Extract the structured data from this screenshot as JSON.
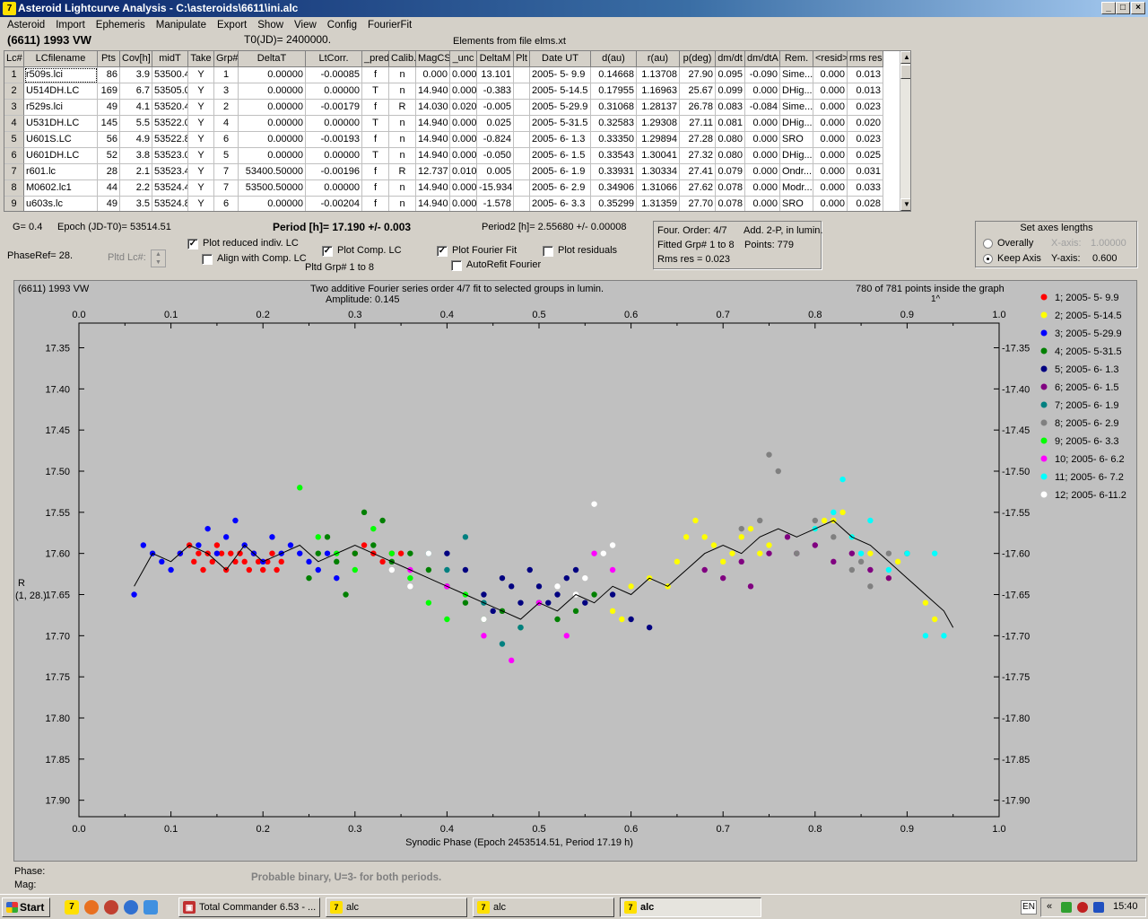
{
  "window": {
    "title": "Asteroid Lightcurve Analysis - C:\\asteroids\\6611\\ini.alc",
    "min": "_",
    "max": "□",
    "close": "×"
  },
  "menu": [
    "Asteroid",
    "Import",
    "Ephemeris",
    "Manipulate",
    "Export",
    "Show",
    "View",
    "Config",
    "FourierFit"
  ],
  "header": {
    "asteroid": "(6611) 1993 VW",
    "t0": "T0(JD)= 2400000.",
    "elements": "Elements from file elms.xt"
  },
  "table": {
    "columns": [
      "Lc#",
      "LCfilename",
      "Pts",
      "Cov[h]",
      "midT",
      "Take",
      "Grp#",
      "DeltaT",
      "LtCorr.",
      "_pred.",
      "Calib.",
      "MagCS",
      "_unc",
      "DeltaM",
      "Plt",
      "Date UT",
      "d(au)",
      "r(au)",
      "p(deg)",
      "dm/dt",
      "dm/dtA",
      "Rem.",
      "<resid>",
      "rms res"
    ],
    "rows": [
      [
        "1",
        "r509s.lci",
        "86",
        "3.9",
        "53500.4",
        "Y",
        "1",
        "0.00000",
        "-0.00085",
        "f",
        "n",
        "0.000",
        "0.000",
        "13.101",
        "",
        "2005- 5- 9.9",
        "0.14668",
        "1.13708",
        "27.90",
        "0.095",
        "-0.090",
        "Sime...",
        "0.000",
        "0.013"
      ],
      [
        "2",
        "U514DH.LC",
        "169",
        "6.7",
        "53505.0",
        "Y",
        "3",
        "0.00000",
        "0.00000",
        "T",
        "n",
        "14.940",
        "0.000",
        "-0.383",
        "",
        "2005- 5-14.5",
        "0.17955",
        "1.16963",
        "25.67",
        "0.099",
        "0.000",
        "DHig...",
        "0.000",
        "0.013"
      ],
      [
        "3",
        "r529s.lci",
        "49",
        "4.1",
        "53520.4",
        "Y",
        "2",
        "0.00000",
        "-0.00179",
        "f",
        "R",
        "14.030",
        "0.020",
        "-0.005",
        "",
        "2005- 5-29.9",
        "0.31068",
        "1.28137",
        "26.78",
        "0.083",
        "-0.084",
        "Sime...",
        "0.000",
        "0.023"
      ],
      [
        "4",
        "U531DH.LC",
        "145",
        "5.5",
        "53522.0",
        "Y",
        "4",
        "0.00000",
        "0.00000",
        "T",
        "n",
        "14.940",
        "0.000",
        "0.025",
        "",
        "2005- 5-31.5",
        "0.32583",
        "1.29308",
        "27.11",
        "0.081",
        "0.000",
        "DHig...",
        "0.000",
        "0.020"
      ],
      [
        "5",
        "U601S.LC",
        "56",
        "4.9",
        "53522.8",
        "Y",
        "6",
        "0.00000",
        "-0.00193",
        "f",
        "n",
        "14.940",
        "0.000",
        "-0.824",
        "",
        "2005- 6- 1.3",
        "0.33350",
        "1.29894",
        "27.28",
        "0.080",
        "0.000",
        "SRO",
        "0.000",
        "0.023"
      ],
      [
        "6",
        "U601DH.LC",
        "52",
        "3.8",
        "53523.0",
        "Y",
        "5",
        "0.00000",
        "0.00000",
        "T",
        "n",
        "14.940",
        "0.000",
        "-0.050",
        "",
        "2005- 6- 1.5",
        "0.33543",
        "1.30041",
        "27.32",
        "0.080",
        "0.000",
        "DHig...",
        "0.000",
        "0.025"
      ],
      [
        "7",
        "r601.lc",
        "28",
        "2.1",
        "53523.4",
        "Y",
        "7",
        "53400.50000",
        "-0.00196",
        "f",
        "R",
        "12.737",
        "0.010",
        "0.005",
        "",
        "2005- 6- 1.9",
        "0.33931",
        "1.30334",
        "27.41",
        "0.079",
        "0.000",
        "Ondr...",
        "0.000",
        "0.031"
      ],
      [
        "8",
        "M0602.lc1",
        "44",
        "2.2",
        "53524.4",
        "Y",
        "7",
        "53500.50000",
        "0.00000",
        "f",
        "n",
        "14.940",
        "0.000",
        "-15.934",
        "",
        "2005- 6- 2.9",
        "0.34906",
        "1.31066",
        "27.62",
        "0.078",
        "0.000",
        "Modr...",
        "0.000",
        "0.033"
      ],
      [
        "9",
        "u603s.lc",
        "49",
        "3.5",
        "53524.8",
        "Y",
        "6",
        "0.00000",
        "-0.00204",
        "f",
        "n",
        "14.940",
        "0.000",
        "-1.578",
        "",
        "2005- 6- 3.3",
        "0.35299",
        "1.31359",
        "27.70",
        "0.078",
        "0.000",
        "SRO",
        "0.000",
        "0.028"
      ]
    ]
  },
  "info": {
    "g": "G= 0.4",
    "epoch": "Epoch (JD-T0)= 53514.51",
    "period": "Period [h]= 17.190 +/- 0.003",
    "period2": "Period2 [h]= 2.55680 +/- 0.00008",
    "phaseref": "PhaseRef= 28.",
    "pltd_lc": "Pltd Lc#:",
    "plot_reduced": "Plot reduced indiv. LC",
    "align": "Align with Comp. LC",
    "plot_comp": "Plot Comp. LC",
    "pltd_grp": "Pltd Grp#  1  to  8",
    "plot_fourier": "Plot Fourier Fit",
    "plot_resid": "Plot residuals",
    "autorefit": "AutoRefit Fourier",
    "four_order": "Four. Order:  4/7",
    "add2p": "Add. 2-P, in lumin.",
    "fitted": "Fitted Grp# 1 to 8",
    "points": "Points: 779",
    "rms": "Rms res      = 0.023"
  },
  "axes_box": {
    "title": "Set axes lengths",
    "overally": "Overally",
    "keep": "Keep Axis",
    "xaxis_lbl": "X-axis:",
    "xaxis_val": "1.00000",
    "yaxis_lbl": "Y-axis:",
    "yaxis_val": "0.600"
  },
  "plot_header": {
    "name": "(6611) 1993 VW",
    "desc": "Two additive Fourier series order 4/7 fit to selected groups in lumin.",
    "amplitude": "Amplitude: 0.145",
    "inside": "780 of 781 points inside the graph",
    "caret": "1^"
  },
  "chart_data": {
    "type": "scatter",
    "xlabel": "Synodic Phase (Epoch 2453514.51, Period 17.19 h)",
    "ylabel": "R",
    "ylabel2": "(1, 28.)",
    "xlim": [
      0.0,
      1.0
    ],
    "ylim": [
      17.92,
      17.32
    ],
    "xticks": [
      "0.0",
      "0.1",
      "0.2",
      "0.3",
      "0.4",
      "0.5",
      "0.6",
      "0.7",
      "0.8",
      "0.9",
      "1.0"
    ],
    "yticks": [
      "17.35",
      "17.40",
      "17.45",
      "17.50",
      "17.55",
      "17.60",
      "17.65",
      "17.70",
      "17.75",
      "17.80",
      "17.85",
      "17.90"
    ],
    "legend_position": "right",
    "series": [
      {
        "name": "1; 2005- 5- 9.9",
        "color": "#ff0000",
        "x": [
          0.11,
          0.12,
          0.125,
          0.13,
          0.135,
          0.14,
          0.145,
          0.15,
          0.155,
          0.16,
          0.165,
          0.17,
          0.175,
          0.18,
          0.185,
          0.19,
          0.195,
          0.2,
          0.205,
          0.21,
          0.215,
          0.22,
          0.3,
          0.31,
          0.32,
          0.33,
          0.34,
          0.35
        ],
        "y": [
          17.6,
          17.59,
          17.61,
          17.6,
          17.62,
          17.6,
          17.61,
          17.59,
          17.6,
          17.62,
          17.6,
          17.61,
          17.6,
          17.61,
          17.62,
          17.6,
          17.61,
          17.62,
          17.61,
          17.6,
          17.62,
          17.61,
          17.6,
          17.59,
          17.6,
          17.61,
          17.6,
          17.6
        ]
      },
      {
        "name": "2; 2005- 5-14.5",
        "color": "#ffff00",
        "x": [
          0.66,
          0.67,
          0.68,
          0.69,
          0.7,
          0.71,
          0.72,
          0.73,
          0.74,
          0.75,
          0.8,
          0.81,
          0.82,
          0.83,
          0.84,
          0.86,
          0.88,
          0.89,
          0.9,
          0.92,
          0.93,
          0.58,
          0.59,
          0.6,
          0.62,
          0.64,
          0.65
        ],
        "y": [
          17.58,
          17.56,
          17.58,
          17.59,
          17.61,
          17.6,
          17.58,
          17.57,
          17.6,
          17.59,
          17.57,
          17.56,
          17.56,
          17.55,
          17.58,
          17.6,
          17.63,
          17.61,
          17.6,
          17.66,
          17.68,
          17.67,
          17.68,
          17.64,
          17.63,
          17.64,
          17.61
        ]
      },
      {
        "name": "3; 2005- 5-29.9",
        "color": "#0000ff",
        "x": [
          0.06,
          0.07,
          0.08,
          0.09,
          0.1,
          0.11,
          0.13,
          0.14,
          0.15,
          0.16,
          0.17,
          0.18,
          0.19,
          0.2,
          0.21,
          0.22,
          0.23,
          0.24,
          0.25,
          0.26,
          0.27,
          0.28
        ],
        "y": [
          17.65,
          17.59,
          17.6,
          17.61,
          17.62,
          17.6,
          17.59,
          17.57,
          17.6,
          17.58,
          17.56,
          17.59,
          17.6,
          17.61,
          17.58,
          17.6,
          17.59,
          17.6,
          17.61,
          17.62,
          17.6,
          17.63
        ]
      },
      {
        "name": "4; 2005- 5-31.5",
        "color": "#008000",
        "x": [
          0.25,
          0.26,
          0.27,
          0.28,
          0.29,
          0.3,
          0.31,
          0.32,
          0.33,
          0.34,
          0.36,
          0.38,
          0.4,
          0.42,
          0.44,
          0.46,
          0.48,
          0.5,
          0.52,
          0.54,
          0.56
        ],
        "y": [
          17.63,
          17.6,
          17.58,
          17.61,
          17.65,
          17.6,
          17.55,
          17.59,
          17.56,
          17.61,
          17.6,
          17.62,
          17.64,
          17.66,
          17.68,
          17.67,
          17.69,
          17.66,
          17.68,
          17.67,
          17.65
        ]
      },
      {
        "name": "5; 2005- 6- 1.3",
        "color": "#000080",
        "x": [
          0.4,
          0.42,
          0.44,
          0.45,
          0.46,
          0.47,
          0.48,
          0.49,
          0.5,
          0.51,
          0.52,
          0.53,
          0.54,
          0.55,
          0.58,
          0.6,
          0.62
        ],
        "y": [
          17.6,
          17.62,
          17.65,
          17.67,
          17.63,
          17.64,
          17.66,
          17.62,
          17.64,
          17.66,
          17.65,
          17.63,
          17.62,
          17.66,
          17.65,
          17.68,
          17.69
        ]
      },
      {
        "name": "6; 2005- 6- 1.5",
        "color": "#800080",
        "x": [
          0.68,
          0.7,
          0.72,
          0.73,
          0.75,
          0.77,
          0.78,
          0.8,
          0.82,
          0.84,
          0.86,
          0.88,
          0.9
        ],
        "y": [
          17.62,
          17.63,
          17.61,
          17.64,
          17.6,
          17.58,
          17.6,
          17.59,
          17.61,
          17.6,
          17.62,
          17.63,
          17.6
        ]
      },
      {
        "name": "7; 2005- 6- 1.9",
        "color": "#008080",
        "x": [
          0.38,
          0.4,
          0.42,
          0.44,
          0.46,
          0.48,
          0.5
        ],
        "y": [
          17.6,
          17.62,
          17.58,
          17.66,
          17.71,
          17.69,
          17.66
        ]
      },
      {
        "name": "8; 2005- 6- 2.9",
        "color": "#808080",
        "x": [
          0.72,
          0.74,
          0.75,
          0.76,
          0.78,
          0.8,
          0.82,
          0.84,
          0.85,
          0.86,
          0.88
        ],
        "y": [
          17.57,
          17.56,
          17.48,
          17.5,
          17.6,
          17.56,
          17.58,
          17.62,
          17.61,
          17.64,
          17.6
        ]
      },
      {
        "name": "9; 2005- 6- 3.3",
        "color": "#00ff00",
        "x": [
          0.24,
          0.26,
          0.28,
          0.3,
          0.32,
          0.34,
          0.36,
          0.38,
          0.4,
          0.42
        ],
        "y": [
          17.52,
          17.58,
          17.6,
          17.62,
          17.57,
          17.6,
          17.63,
          17.66,
          17.68,
          17.65
        ]
      },
      {
        "name": "10; 2005- 6- 6.2",
        "color": "#ff00ff",
        "x": [
          0.36,
          0.4,
          0.44,
          0.47,
          0.5,
          0.53,
          0.56,
          0.58
        ],
        "y": [
          17.62,
          17.64,
          17.7,
          17.73,
          17.66,
          17.7,
          17.6,
          17.62
        ]
      },
      {
        "name": "11; 2005- 6- 7.2",
        "color": "#00ffff",
        "x": [
          0.8,
          0.82,
          0.83,
          0.84,
          0.85,
          0.86,
          0.88,
          0.9,
          0.92,
          0.93,
          0.94
        ],
        "y": [
          17.57,
          17.55,
          17.51,
          17.58,
          17.6,
          17.56,
          17.62,
          17.6,
          17.7,
          17.6,
          17.7
        ]
      },
      {
        "name": "12; 2005- 6-11.2",
        "color": "#ffffff",
        "x": [
          0.34,
          0.36,
          0.38,
          0.44,
          0.52,
          0.54,
          0.55,
          0.56,
          0.57,
          0.58
        ],
        "y": [
          17.62,
          17.64,
          17.6,
          17.68,
          17.64,
          17.65,
          17.63,
          17.54,
          17.6,
          17.59
        ]
      }
    ],
    "fit": {
      "x": [
        0.06,
        0.08,
        0.1,
        0.12,
        0.14,
        0.16,
        0.18,
        0.2,
        0.22,
        0.24,
        0.26,
        0.28,
        0.3,
        0.32,
        0.34,
        0.36,
        0.38,
        0.4,
        0.42,
        0.44,
        0.46,
        0.48,
        0.5,
        0.52,
        0.54,
        0.56,
        0.58,
        0.6,
        0.62,
        0.64,
        0.66,
        0.68,
        0.7,
        0.72,
        0.74,
        0.76,
        0.78,
        0.8,
        0.82,
        0.84,
        0.86,
        0.88,
        0.9,
        0.92,
        0.94,
        0.95
      ],
      "y": [
        17.64,
        17.6,
        17.61,
        17.59,
        17.6,
        17.62,
        17.59,
        17.61,
        17.6,
        17.59,
        17.61,
        17.6,
        17.59,
        17.6,
        17.61,
        17.62,
        17.63,
        17.64,
        17.65,
        17.66,
        17.67,
        17.68,
        17.66,
        17.67,
        17.65,
        17.66,
        17.64,
        17.65,
        17.63,
        17.64,
        17.62,
        17.6,
        17.59,
        17.6,
        17.58,
        17.57,
        17.58,
        17.57,
        17.56,
        17.58,
        17.59,
        17.61,
        17.63,
        17.65,
        17.67,
        17.69
      ]
    }
  },
  "footer": {
    "phase": "Phase:",
    "mag": "Mag:",
    "note": "Probable binary, U=3- for both periods."
  },
  "taskbar": {
    "start": "Start",
    "tasks": [
      "Total Commander 6.53 - ...",
      "alc",
      "alc",
      "alc"
    ],
    "lang": "EN",
    "time": "15:40"
  }
}
